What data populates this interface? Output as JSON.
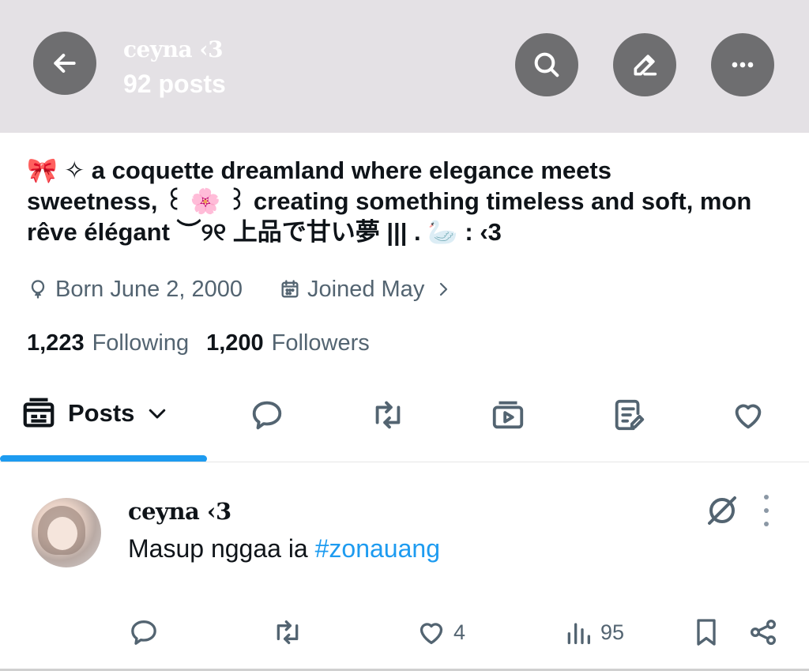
{
  "header": {
    "title": "ceyna ‹3",
    "post_count": "92 posts",
    "icons": [
      "back-arrow-icon",
      "search-icon",
      "edit-icon",
      "more-icon"
    ]
  },
  "bio": {
    "line1": "🎀 ✧ a coquette dreamland where elegance meets",
    "line2": "sweetness, ꒰ 🌸 ꒱ creating something timeless and soft, mon",
    "line3": "rêve élégant      ︶୨୧ 上品で甘い夢 ||| . 🦢 : ‹3"
  },
  "meta": {
    "birthday": "Born June 2, 2000",
    "joined": "Joined May"
  },
  "stats": {
    "following_count": "1,223",
    "following_label": "Following",
    "followers_count": "1,200",
    "followers_label": "Followers"
  },
  "tabs": {
    "active_label": "Posts",
    "icons": [
      "posts-icon",
      "replies-icon",
      "reposts-icon",
      "media-icon",
      "articles-icon",
      "likes-icon"
    ]
  },
  "tweet": {
    "name": "ceyna ‹3",
    "text": "Masup nggaa ia ",
    "hashtag": "#zonauang",
    "likes": "4",
    "views": "95"
  },
  "colors": {
    "accent": "#1d9bf0",
    "header_bg": "#e4e1e5",
    "circle_button": "#6e6e70",
    "secondary_text": "#536471"
  }
}
